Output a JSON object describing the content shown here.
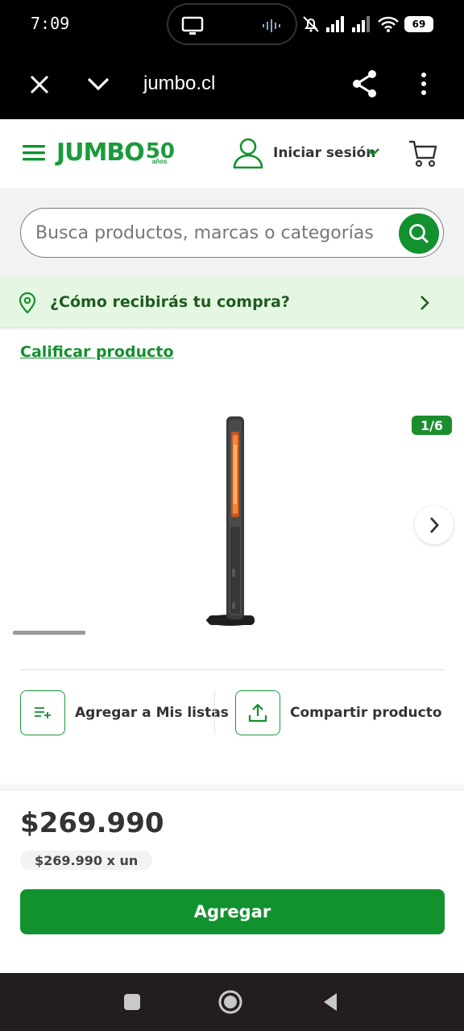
{
  "status_bar": {
    "time": "7:09",
    "battery": "69"
  },
  "browser": {
    "url": "jumbo.cl"
  },
  "header": {
    "logo_text": "JUMBO",
    "logo_badge_number": "50",
    "logo_badge_text": "años",
    "login_label": "Iniciar sesión"
  },
  "search": {
    "placeholder": "Busca productos, marcas o categorías"
  },
  "delivery": {
    "label": "¿Cómo recibirás tu compra?"
  },
  "product": {
    "rate_link": "Calificar producto",
    "image_counter": "1/6",
    "actions": {
      "add_to_list": "Agregar a Mis listas",
      "share": "Compartir producto"
    },
    "price": "$269.990",
    "unit_price": "$269.990 x un",
    "add_button": "Agregar"
  },
  "colors": {
    "brand_green": "#12912f",
    "banner_green": "#e5f7e2",
    "text_dark": "#333333"
  },
  "icons": [
    "close-icon",
    "chevron-down-icon",
    "share-icon",
    "more-vert-icon",
    "menu-icon",
    "user-icon",
    "cart-icon",
    "search-icon",
    "location-pin-icon",
    "chevron-right-icon",
    "add-list-icon",
    "upload-icon"
  ]
}
